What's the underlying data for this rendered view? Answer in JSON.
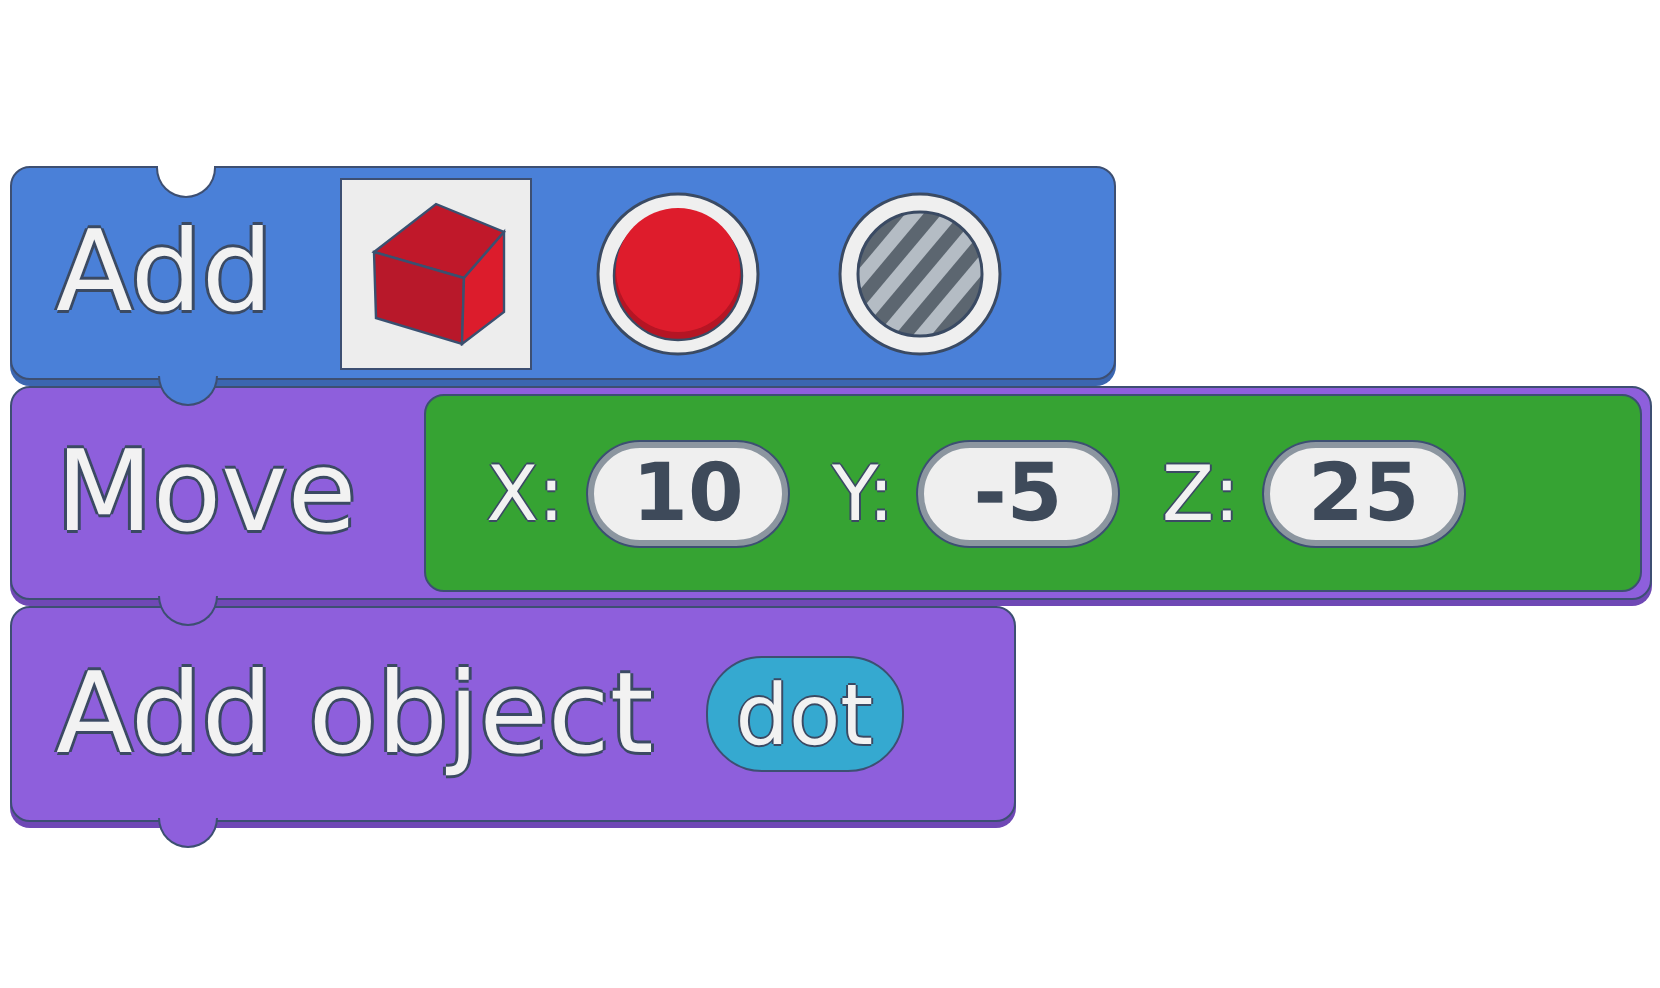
{
  "blocks": [
    {
      "kind": "add",
      "label": "Add",
      "options": [
        {
          "kind": "cube",
          "selected": true
        },
        {
          "kind": "solid",
          "selected": false
        },
        {
          "kind": "striped",
          "selected": false
        }
      ]
    },
    {
      "kind": "move",
      "label": "Move",
      "fields": [
        {
          "label": "X:",
          "value": "10"
        },
        {
          "label": "Y:",
          "value": "-5"
        },
        {
          "label": "Z:",
          "value": "25"
        }
      ]
    },
    {
      "kind": "add-object",
      "label": "Add object",
      "chip": "dot"
    }
  ]
}
